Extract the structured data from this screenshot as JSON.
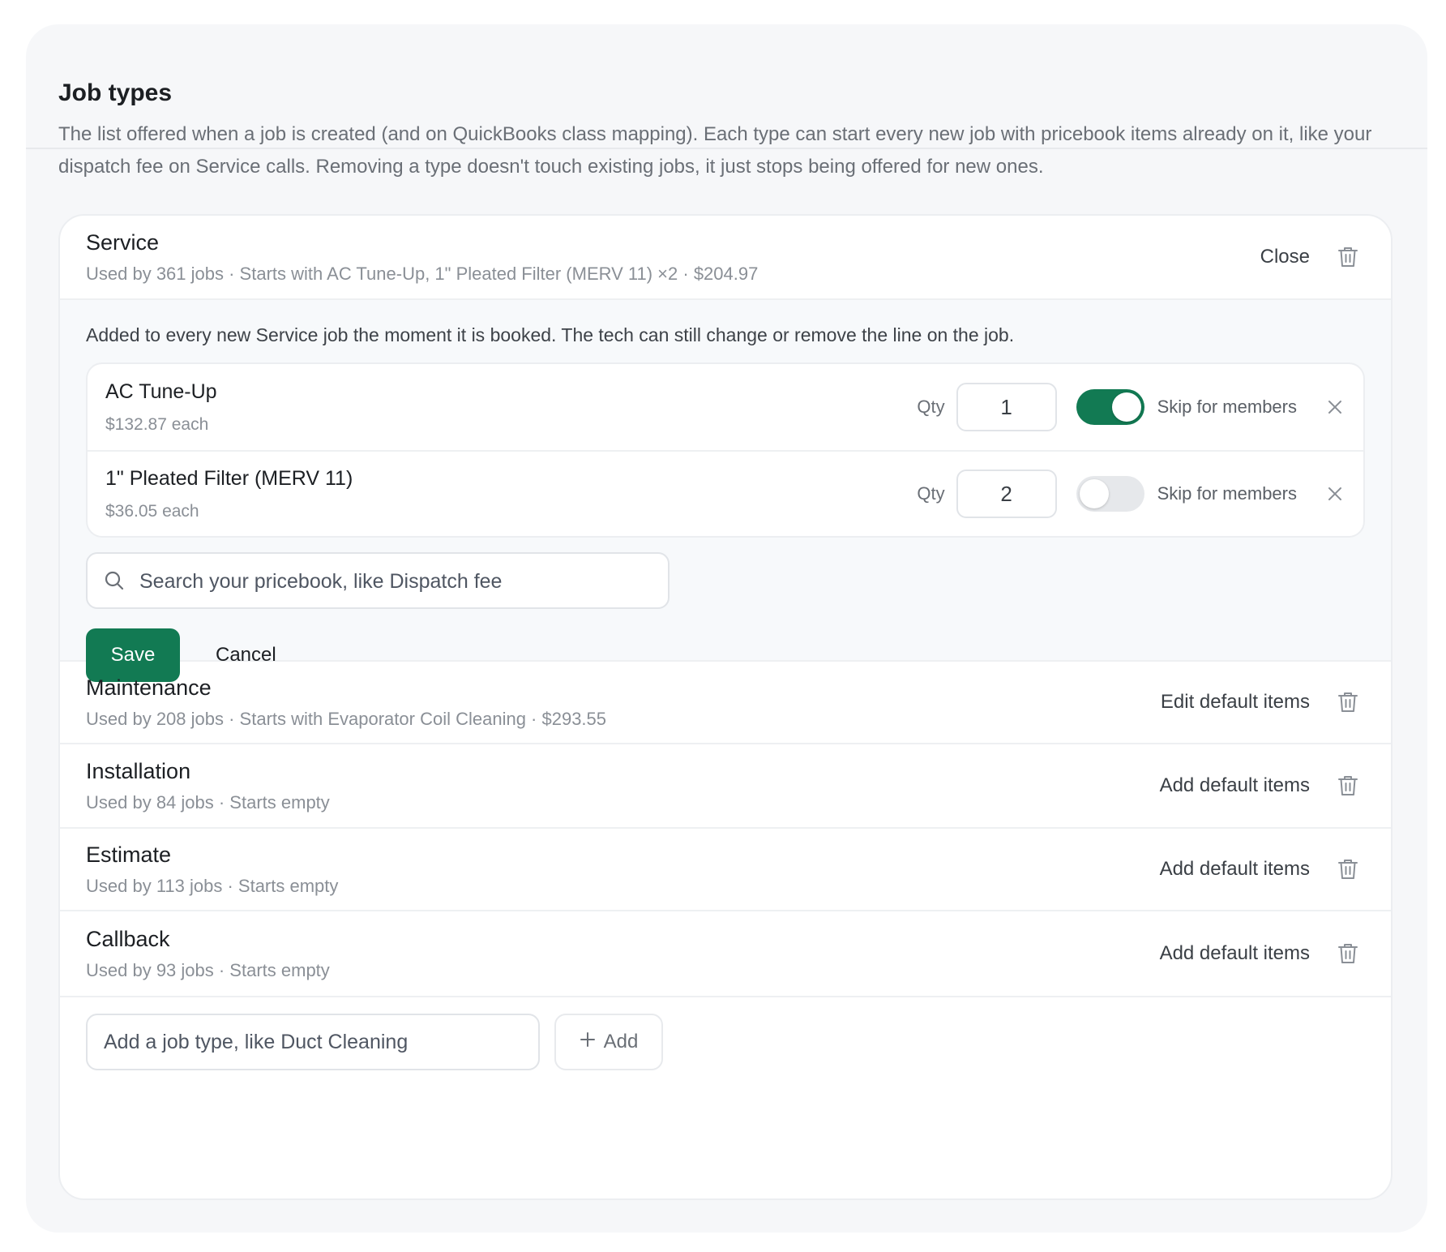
{
  "section": {
    "title": "Job types",
    "description": "The list offered when a job is created (and on QuickBooks class mapping). Each type can start every new job with pricebook items already on it, like your dispatch fee on Service calls. Removing a type doesn't touch existing jobs, it just stops being offered for new ones."
  },
  "job_types": [
    {
      "name": "Service",
      "meta": "Used by 361 jobs · Starts with AC Tune-Up, 1\" Pleated Filter (MERV 11) ×2 · $204.97",
      "action": "Close"
    },
    {
      "name": "Maintenance",
      "meta": "Used by 208 jobs · Starts with Evaporator Coil Cleaning · $293.55",
      "action": "Edit default items"
    },
    {
      "name": "Installation",
      "meta": "Used by 84 jobs · Starts empty",
      "action": "Add default items"
    },
    {
      "name": "Estimate",
      "meta": "Used by 113 jobs · Starts empty",
      "action": "Add default items"
    },
    {
      "name": "Callback",
      "meta": "Used by 93 jobs · Starts empty",
      "action": "Add default items"
    }
  ],
  "editor": {
    "note": "Added to every new Service job the moment it is booked. The tech can still change or remove the line on the job.",
    "items": [
      {
        "name": "AC Tune-Up",
        "price": "$132.87 each",
        "qty_label": "Qty",
        "qty": "1",
        "skip_label": "Skip for members",
        "skip_for_members": true
      },
      {
        "name": "1\" Pleated Filter (MERV 11)",
        "price": "$36.05 each",
        "qty_label": "Qty",
        "qty": "2",
        "skip_label": "Skip for members",
        "skip_for_members": false
      }
    ],
    "search_placeholder": "Search your pricebook, like Dispatch fee",
    "save_label": "Save",
    "cancel_label": "Cancel"
  },
  "add": {
    "placeholder": "Add a job type, like Duct Cleaning",
    "button_label": "Add"
  },
  "colors": {
    "accent": "#127a53",
    "card_bg": "#f6f7f9",
    "muted_text": "#8a8f96"
  }
}
